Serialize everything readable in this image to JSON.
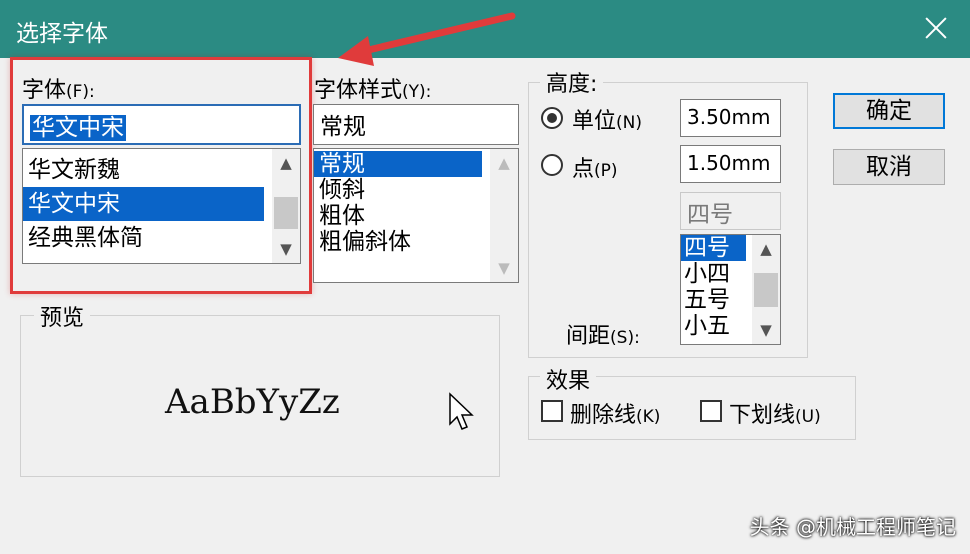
{
  "window": {
    "title": "选择字体"
  },
  "font": {
    "label": "字体",
    "hotkey": "(F):",
    "input_value": "华文中宋",
    "items": [
      "华文新魏",
      "华文中宋",
      "经典黑体简"
    ],
    "selected_index": 1
  },
  "style": {
    "label": "字体样式",
    "hotkey": "(Y):",
    "input_value": "常规",
    "items": [
      "常规",
      "倾斜",
      "粗体",
      "粗偏斜体"
    ],
    "selected_index": 0
  },
  "height": {
    "label": "高度:",
    "unit_label": "单位",
    "unit_hotkey": "(N)",
    "unit_value": "3.50mm",
    "point_label": "点",
    "point_hotkey": "(P)",
    "point_value": "1.50mm",
    "size_input": "四号",
    "size_items": [
      "四号",
      "小四",
      "五号",
      "小五"
    ],
    "spacing_label": "间距",
    "spacing_hotkey": "(S):"
  },
  "preview": {
    "label": "预览",
    "sample": "AaBbYyZz"
  },
  "effects": {
    "label": "效果",
    "strike_label": "删除线",
    "strike_hotkey": "(K)",
    "underline_label": "下划线",
    "underline_hotkey": "(U)"
  },
  "buttons": {
    "ok": "确定",
    "cancel": "取消"
  },
  "watermark": "头条 @机械工程师笔记",
  "colors": {
    "titlebar": "#2b8b83",
    "selection": "#0a64c8",
    "annotation": "#e03b3b"
  }
}
